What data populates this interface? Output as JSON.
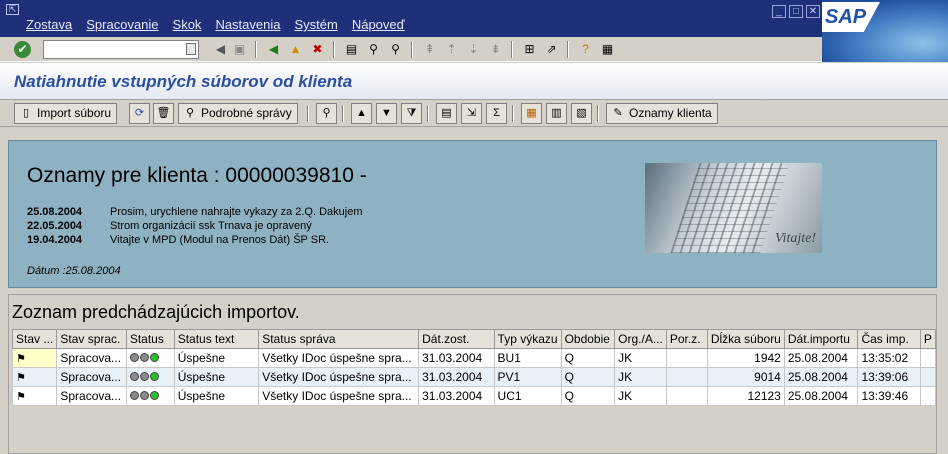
{
  "menu": {
    "items": [
      "Zostava",
      "Spracovanie",
      "Skok",
      "Nastavenia",
      "Systém",
      "Nápoveď"
    ],
    "window_buttons": [
      "_",
      "□",
      "✕"
    ],
    "logo": "SAP"
  },
  "std_toolbar": {
    "command_value": ""
  },
  "title": "Natiahnutie vstupných súborov od klienta",
  "app_toolbar": {
    "import_label": "Import súboru",
    "details_label": "Podrobné správy",
    "announcements_label": "Oznamy klienta"
  },
  "announcements": {
    "heading": "Oznamy pre klienta : 00000039810 -",
    "items": [
      {
        "date": "25.08.2004",
        "text": "Prosim, urychlene nahrajte vykazy za 2.Q. Dakujem"
      },
      {
        "date": "22.05.2004",
        "text": "Strom organizácií ssk Trnava je opravený"
      },
      {
        "date": "19.04.2004",
        "text": "Vitajte v MPD (Modul na Prenos Dát) ŠP SR."
      }
    ],
    "date_line": "Dátum :25.08.2004",
    "banner_text": "Vitajte!"
  },
  "imports": {
    "heading": "Zoznam predchádzajúcich importov.",
    "columns": [
      "Stav ...",
      "Stav sprac.",
      "Status",
      "Status text",
      "Status správa",
      "Dát.zost.",
      "Typ výkazu",
      "Obdobie",
      "Org./A...",
      "Por.z.",
      "Dĺžka súboru",
      "Dát.importu",
      "Čas imp.",
      "P"
    ],
    "rows": [
      {
        "stav": "⚑",
        "sprac": "Spracova...",
        "status_text": "Úspešne",
        "sprava": "Všetky IDoc úspešne spra...",
        "dat_zost": "31.03.2004",
        "typ": "BU1",
        "obdobie": "Q",
        "org": "JK",
        "porz": "",
        "dlzka": "1942",
        "dat_imp": "25.08.2004",
        "cas": "13:35:02"
      },
      {
        "stav": "⚑",
        "sprac": "Spracova...",
        "status_text": "Úspešne",
        "sprava": "Všetky IDoc úspešne spra...",
        "dat_zost": "31.03.2004",
        "typ": "PV1",
        "obdobie": "Q",
        "org": "JK",
        "porz": "",
        "dlzka": "9014",
        "dat_imp": "25.08.2004",
        "cas": "13:39:06"
      },
      {
        "stav": "⚑",
        "sprac": "Spracova...",
        "status_text": "Úspešne",
        "sprava": "Všetky IDoc úspešne spra...",
        "dat_zost": "31.03.2004",
        "typ": "UC1",
        "obdobie": "Q",
        "org": "JK",
        "porz": "",
        "dlzka": "12123",
        "dat_imp": "25.08.2004",
        "cas": "13:39:46"
      }
    ]
  }
}
